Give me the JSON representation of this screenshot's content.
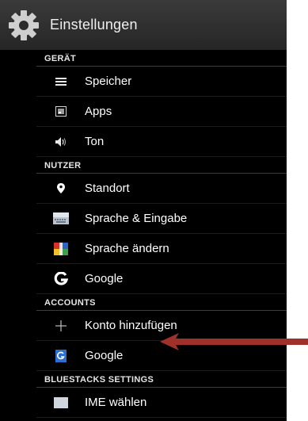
{
  "app": {
    "title": "Einstellungen",
    "icon": "gear-icon"
  },
  "sections": [
    {
      "header": "GERÄT",
      "items": [
        {
          "label": "Speicher",
          "icon": "storage-icon"
        },
        {
          "label": "Apps",
          "icon": "apps-icon"
        },
        {
          "label": "Ton",
          "icon": "sound-icon"
        }
      ]
    },
    {
      "header": "NUTZER",
      "items": [
        {
          "label": "Standort",
          "icon": "location-pin-icon"
        },
        {
          "label": "Sprache & Eingabe",
          "icon": "keyboard-icon"
        },
        {
          "label": "Sprache ändern",
          "icon": "language-flag-icon"
        },
        {
          "label": "Google",
          "icon": "google-g-icon"
        }
      ]
    },
    {
      "header": "ACCOUNTS",
      "items": [
        {
          "label": "Konto hinzufügen",
          "icon": "plus-icon"
        },
        {
          "label": "Google",
          "icon": "google-account-icon"
        }
      ]
    },
    {
      "header": "BLUESTACKS SETTINGS",
      "items": [
        {
          "label": "IME wählen",
          "icon": "ime-icon"
        }
      ]
    }
  ],
  "annotation": {
    "arrow_color": "#a0302a",
    "points_to": "Konto hinzufügen"
  }
}
